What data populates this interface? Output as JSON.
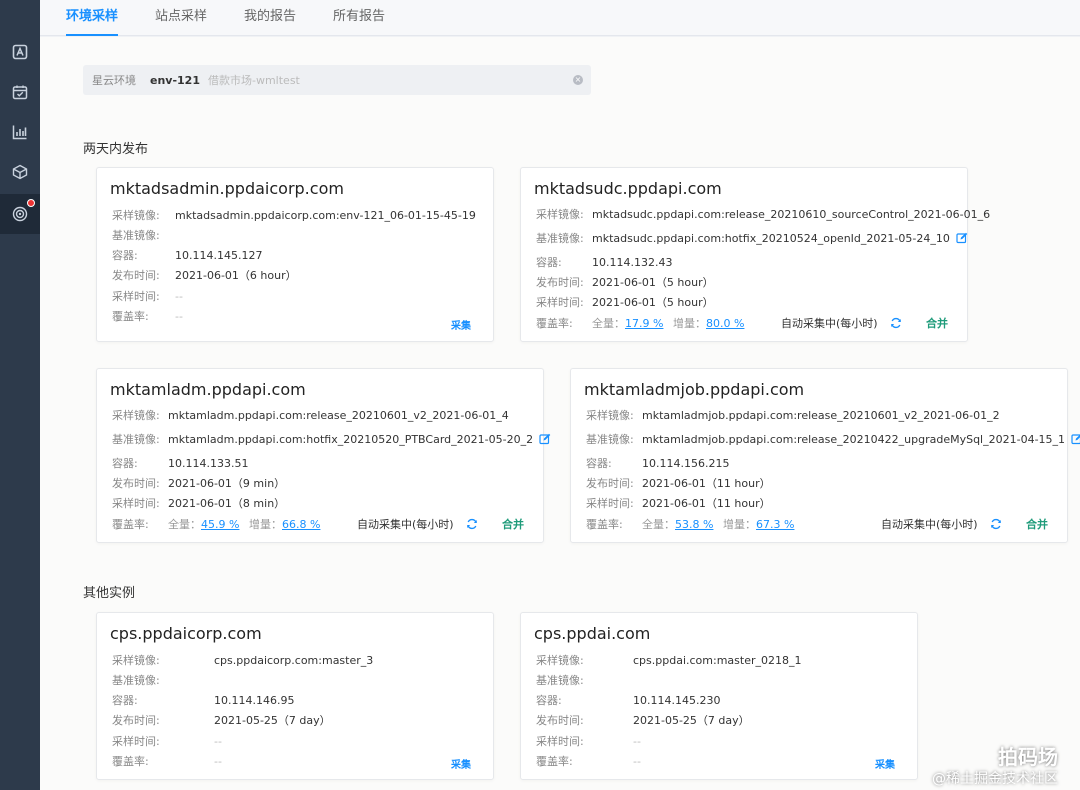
{
  "tabs": [
    {
      "label": "环境采样",
      "active": true
    },
    {
      "label": "站点采样",
      "active": false
    },
    {
      "label": "我的报告",
      "active": false
    },
    {
      "label": "所有报告",
      "active": false
    }
  ],
  "sidebar": {
    "icons": [
      "app-logo-icon",
      "calendar-check-icon",
      "bar-chart-icon",
      "cube-icon",
      "target-icon"
    ],
    "badge_color": "#e33333"
  },
  "env": {
    "label": "星云环境",
    "value": "env-121",
    "hint": "借款市场-wmltest",
    "clear_glyph": "×"
  },
  "labels": {
    "image": "采样镜像:",
    "base": "基准镜像:",
    "container": "容器:",
    "release_time": "发布时间:",
    "sample_time": "采样时间:",
    "coverage": "覆盖率:",
    "all": "全量：",
    "inc": "增量：",
    "auto": "自动采集中(每小时)",
    "merge": "合并",
    "sample": "采集"
  },
  "sections": {
    "recent": "两天内发布",
    "other": "其他实例"
  },
  "cards": [
    {
      "title": "mktadsadmin.ppdaicorp.com",
      "image": "mktadsadmin.ppdaicorp.com:env-121_06-01-15-45-19",
      "base": "",
      "container": "10.114.145.127",
      "release_time": "2021-06-01（6 hour）",
      "sample_time": "--",
      "coverage": "--"
    },
    {
      "title": "mktadsudc.ppdapi.com",
      "image": "mktadsudc.ppdapi.com:release_20210610_sourceControl_2021-06-01_6",
      "base": "mktadsudc.ppdapi.com:hotfix_20210524_openId_2021-05-24_10",
      "container": "10.114.132.43",
      "release_time": "2021-06-01（5 hour）",
      "sample_time": "2021-06-01（5 hour）",
      "cov_all": "17.9 %",
      "cov_inc": "80.0 %"
    },
    {
      "title": "mktamladm.ppdapi.com",
      "image": "mktamladm.ppdapi.com:release_20210601_v2_2021-06-01_4",
      "base": "mktamladm.ppdapi.com:hotfix_20210520_PTBCard_2021-05-20_2",
      "container": "10.114.133.51",
      "release_time": "2021-06-01（9 min）",
      "sample_time": "2021-06-01（8 min）",
      "cov_all": "45.9 %",
      "cov_inc": "66.8 %"
    },
    {
      "title": "mktamladmjob.ppdapi.com",
      "image": "mktamladmjob.ppdapi.com:release_20210601_v2_2021-06-01_2",
      "base": "mktamladmjob.ppdapi.com:release_20210422_upgradeMySql_2021-04-15_1",
      "container": "10.114.156.215",
      "release_time": "2021-06-01（11 hour）",
      "sample_time": "2021-06-01（11 hour）",
      "cov_all": "53.8 %",
      "cov_inc": "67.3 %"
    },
    {
      "title": "cps.ppdaicorp.com",
      "image": "cps.ppdaicorp.com:master_3",
      "base": "",
      "container": "10.114.146.95",
      "release_time": "2021-05-25（7 day）",
      "sample_time": "--",
      "coverage": "--"
    },
    {
      "title": "cps.ppdai.com",
      "image": "cps.ppdai.com:master_0218_1",
      "base": "",
      "container": "10.114.145.230",
      "release_time": "2021-05-25（7 day）",
      "sample_time": "--",
      "coverage": "--"
    }
  ],
  "watermark": {
    "line1": "拍码场",
    "line2": "@稀土掘金技术社区"
  },
  "colors": {
    "sidebar": "#2d3a4b",
    "accent": "#1890ff",
    "merge": "#1e9b7a"
  }
}
